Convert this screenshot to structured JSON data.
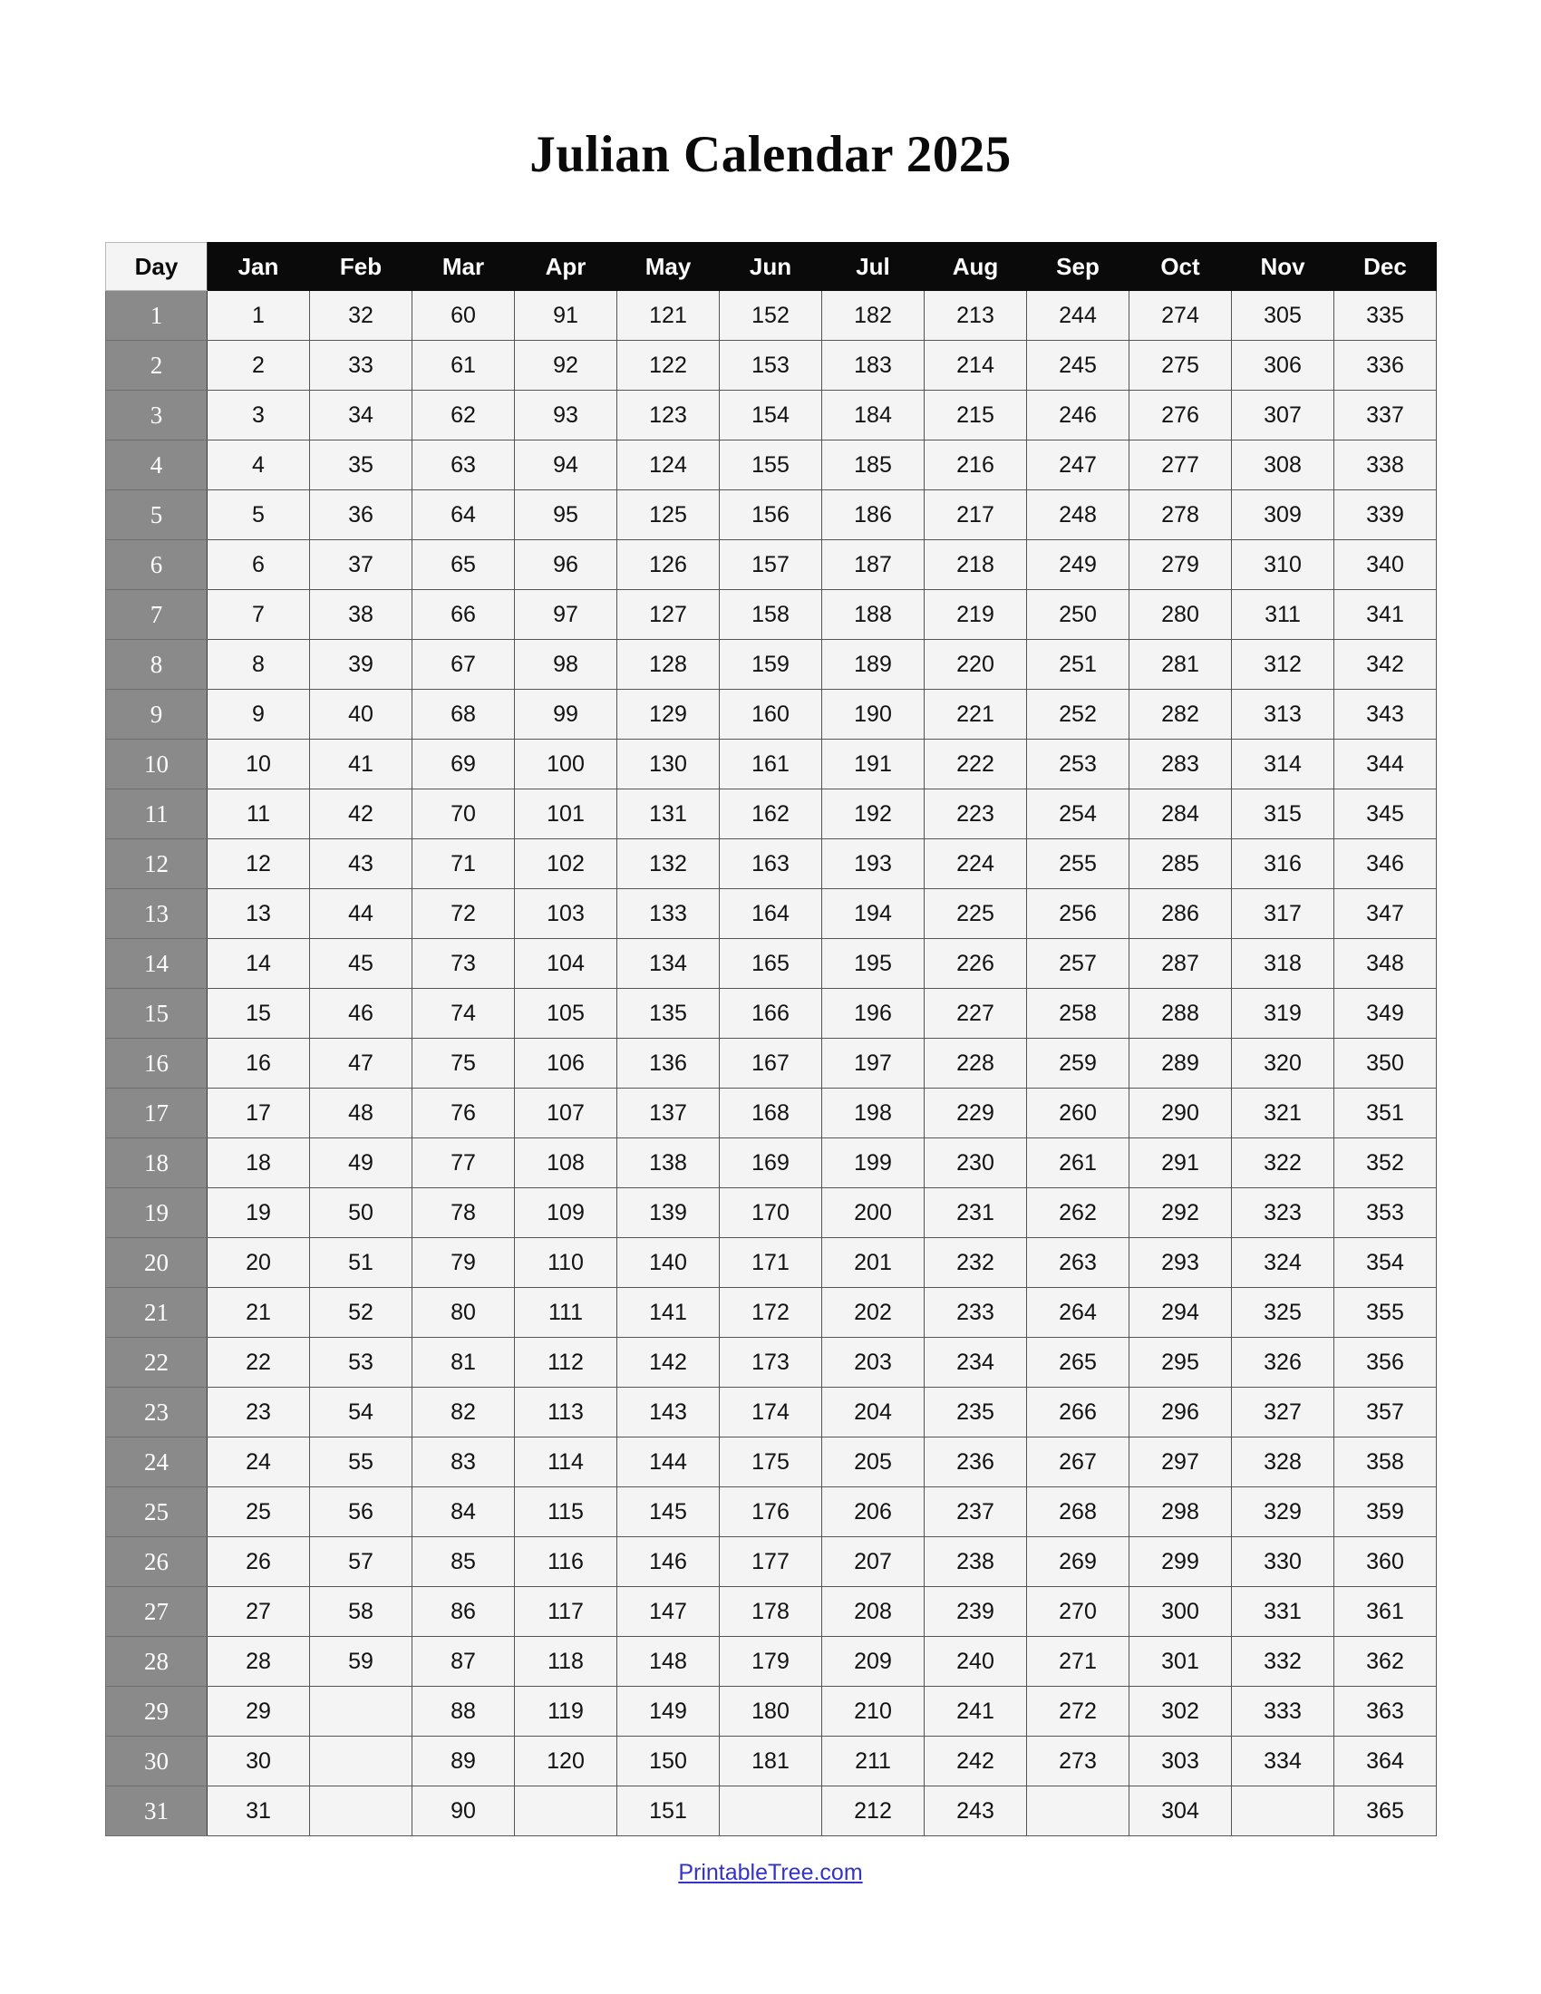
{
  "document": {
    "title": "Julian Calendar 2025"
  },
  "footer": {
    "link_label": "PrintableTree.com",
    "link_color": "#3333cc"
  },
  "colors": {
    "header_background": "#0a0a0a",
    "header_text": "#ffffff",
    "day_header_background": "#f4f4f4",
    "day_header_text": "#0a0a0a",
    "day_column_background": "#8a8a8a",
    "day_column_text": "#ffffff",
    "cell_background": "#f4f4f4",
    "cell_text": "#121212",
    "border": "#555555",
    "page_background": "#ffffff"
  },
  "chart_data": {
    "type": "table",
    "title": "Julian Calendar 2025",
    "columns": [
      "Day",
      "Jan",
      "Feb",
      "Mar",
      "Apr",
      "May",
      "Jun",
      "Jul",
      "Aug",
      "Sep",
      "Oct",
      "Nov",
      "Dec"
    ],
    "rows": [
      [
        "1",
        "1",
        "32",
        "60",
        "91",
        "121",
        "152",
        "182",
        "213",
        "244",
        "274",
        "305",
        "335"
      ],
      [
        "2",
        "2",
        "33",
        "61",
        "92",
        "122",
        "153",
        "183",
        "214",
        "245",
        "275",
        "306",
        "336"
      ],
      [
        "3",
        "3",
        "34",
        "62",
        "93",
        "123",
        "154",
        "184",
        "215",
        "246",
        "276",
        "307",
        "337"
      ],
      [
        "4",
        "4",
        "35",
        "63",
        "94",
        "124",
        "155",
        "185",
        "216",
        "247",
        "277",
        "308",
        "338"
      ],
      [
        "5",
        "5",
        "36",
        "64",
        "95",
        "125",
        "156",
        "186",
        "217",
        "248",
        "278",
        "309",
        "339"
      ],
      [
        "6",
        "6",
        "37",
        "65",
        "96",
        "126",
        "157",
        "187",
        "218",
        "249",
        "279",
        "310",
        "340"
      ],
      [
        "7",
        "7",
        "38",
        "66",
        "97",
        "127",
        "158",
        "188",
        "219",
        "250",
        "280",
        "311",
        "341"
      ],
      [
        "8",
        "8",
        "39",
        "67",
        "98",
        "128",
        "159",
        "189",
        "220",
        "251",
        "281",
        "312",
        "342"
      ],
      [
        "9",
        "9",
        "40",
        "68",
        "99",
        "129",
        "160",
        "190",
        "221",
        "252",
        "282",
        "313",
        "343"
      ],
      [
        "10",
        "10",
        "41",
        "69",
        "100",
        "130",
        "161",
        "191",
        "222",
        "253",
        "283",
        "314",
        "344"
      ],
      [
        "11",
        "11",
        "42",
        "70",
        "101",
        "131",
        "162",
        "192",
        "223",
        "254",
        "284",
        "315",
        "345"
      ],
      [
        "12",
        "12",
        "43",
        "71",
        "102",
        "132",
        "163",
        "193",
        "224",
        "255",
        "285",
        "316",
        "346"
      ],
      [
        "13",
        "13",
        "44",
        "72",
        "103",
        "133",
        "164",
        "194",
        "225",
        "256",
        "286",
        "317",
        "347"
      ],
      [
        "14",
        "14",
        "45",
        "73",
        "104",
        "134",
        "165",
        "195",
        "226",
        "257",
        "287",
        "318",
        "348"
      ],
      [
        "15",
        "15",
        "46",
        "74",
        "105",
        "135",
        "166",
        "196",
        "227",
        "258",
        "288",
        "319",
        "349"
      ],
      [
        "16",
        "16",
        "47",
        "75",
        "106",
        "136",
        "167",
        "197",
        "228",
        "259",
        "289",
        "320",
        "350"
      ],
      [
        "17",
        "17",
        "48",
        "76",
        "107",
        "137",
        "168",
        "198",
        "229",
        "260",
        "290",
        "321",
        "351"
      ],
      [
        "18",
        "18",
        "49",
        "77",
        "108",
        "138",
        "169",
        "199",
        "230",
        "261",
        "291",
        "322",
        "352"
      ],
      [
        "19",
        "19",
        "50",
        "78",
        "109",
        "139",
        "170",
        "200",
        "231",
        "262",
        "292",
        "323",
        "353"
      ],
      [
        "20",
        "20",
        "51",
        "79",
        "110",
        "140",
        "171",
        "201",
        "232",
        "263",
        "293",
        "324",
        "354"
      ],
      [
        "21",
        "21",
        "52",
        "80",
        "111",
        "141",
        "172",
        "202",
        "233",
        "264",
        "294",
        "325",
        "355"
      ],
      [
        "22",
        "22",
        "53",
        "81",
        "112",
        "142",
        "173",
        "203",
        "234",
        "265",
        "295",
        "326",
        "356"
      ],
      [
        "23",
        "23",
        "54",
        "82",
        "113",
        "143",
        "174",
        "204",
        "235",
        "266",
        "296",
        "327",
        "357"
      ],
      [
        "24",
        "24",
        "55",
        "83",
        "114",
        "144",
        "175",
        "205",
        "236",
        "267",
        "297",
        "328",
        "358"
      ],
      [
        "25",
        "25",
        "56",
        "84",
        "115",
        "145",
        "176",
        "206",
        "237",
        "268",
        "298",
        "329",
        "359"
      ],
      [
        "26",
        "26",
        "57",
        "85",
        "116",
        "146",
        "177",
        "207",
        "238",
        "269",
        "299",
        "330",
        "360"
      ],
      [
        "27",
        "27",
        "58",
        "86",
        "117",
        "147",
        "178",
        "208",
        "239",
        "270",
        "300",
        "331",
        "361"
      ],
      [
        "28",
        "28",
        "59",
        "87",
        "118",
        "148",
        "179",
        "209",
        "240",
        "271",
        "301",
        "332",
        "362"
      ],
      [
        "29",
        "29",
        "",
        "88",
        "119",
        "149",
        "180",
        "210",
        "241",
        "272",
        "302",
        "333",
        "363"
      ],
      [
        "30",
        "30",
        "",
        "89",
        "120",
        "150",
        "181",
        "211",
        "242",
        "273",
        "303",
        "334",
        "364"
      ],
      [
        "31",
        "31",
        "",
        "90",
        "",
        "151",
        "",
        "212",
        "243",
        "",
        "304",
        "",
        "365"
      ]
    ]
  }
}
